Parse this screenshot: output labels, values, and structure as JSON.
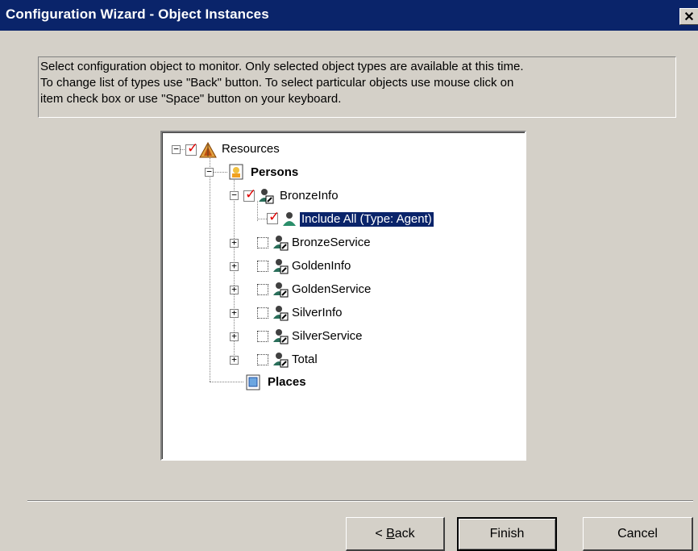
{
  "window": {
    "title": "Configuration Wizard - Object Instances",
    "close_glyph": "✕"
  },
  "instructions": {
    "lines": [
      "Select configuration object to monitor. Only selected object types are available at this time.",
      "To change list of types use \"Back\" button.  To select particular objects use mouse click on",
      "item check box or use \"Space\" button on your keyboard."
    ]
  },
  "tree": {
    "root": {
      "label": "Resources",
      "checked": true,
      "icon": "resources-icon"
    },
    "persons": {
      "label": "Persons",
      "icon": "persons-folder-icon"
    },
    "bronzeinfo": {
      "label": "BronzeInfo",
      "checked": true,
      "icon": "agent-group-icon"
    },
    "include_all": {
      "label": "Include All (Type: Agent)",
      "checked": true,
      "selected": true,
      "icon": "agent-icon"
    },
    "groups": [
      {
        "label": "BronzeService",
        "checked": false
      },
      {
        "label": "GoldenInfo",
        "checked": false
      },
      {
        "label": "GoldenService",
        "checked": false
      },
      {
        "label": "SilverInfo",
        "checked": false
      },
      {
        "label": "SilverService",
        "checked": false
      },
      {
        "label": "Total",
        "checked": false
      }
    ],
    "places": {
      "label": "Places",
      "icon": "places-folder-icon"
    }
  },
  "buttons": {
    "back_prefix": "< ",
    "back_mnemonic": "B",
    "back_rest": "ack",
    "finish": "Finish",
    "cancel": "Cancel"
  },
  "glyphs": {
    "check": "✓",
    "plus": "+",
    "minus": "−"
  }
}
